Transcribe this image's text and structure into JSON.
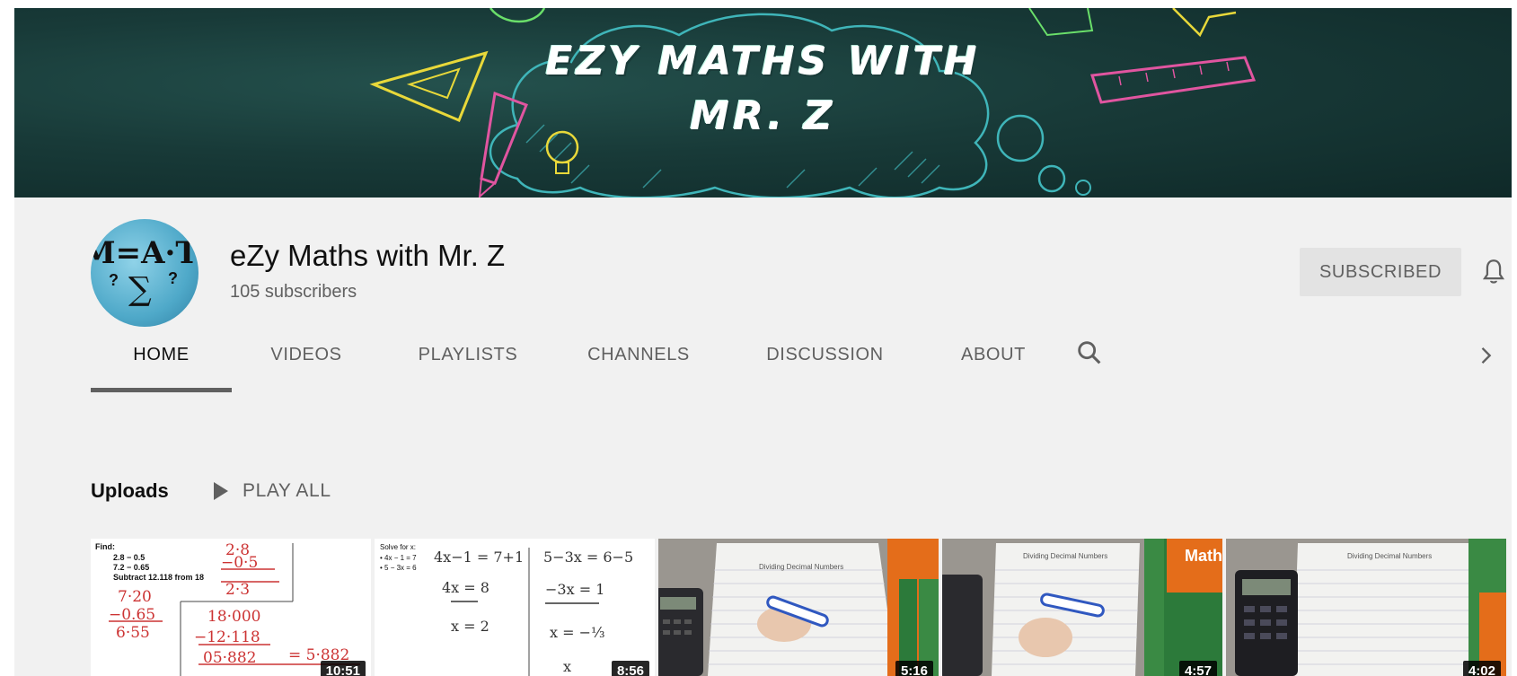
{
  "banner": {
    "title_line1": "EZY MATHS WITH",
    "title_line2": "MR. Z"
  },
  "channel": {
    "name": "eZy Maths with Mr. Z",
    "subscribers": "105 subscribers",
    "avatar_text": "M=A·T+H",
    "avatar_sigma": "∑",
    "subscribe_label": "SUBSCRIBED",
    "colors": {
      "header_bg": "#f1f1f1",
      "button_bg": "#e3e3e3",
      "muted_text": "#606060"
    }
  },
  "tabs": [
    {
      "label": "HOME",
      "active": true
    },
    {
      "label": "VIDEOS",
      "active": false
    },
    {
      "label": "PLAYLISTS",
      "active": false
    },
    {
      "label": "CHANNELS",
      "active": false
    },
    {
      "label": "DISCUSSION",
      "active": false
    },
    {
      "label": "ABOUT",
      "active": false
    }
  ],
  "icons": {
    "search": "search-icon",
    "next": "chevron-right-icon",
    "bell": "bell-icon",
    "play": "play-icon"
  },
  "uploads": {
    "title": "Uploads",
    "play_all_label": "PLAY ALL",
    "videos": [
      {
        "find": "Find:",
        "lines": [
          "2.8 − 0.5",
          "7.2 − 0.65",
          "Subtract 12.118 from 18"
        ],
        "hand": [
          "2·8",
          "−0·5",
          "2·3",
          "7·20",
          "−0.65",
          "6·55",
          "18·000",
          "−12·118",
          "05·882",
          "= 5·882"
        ],
        "duration": "10:51"
      },
      {
        "title": "Solve for x:",
        "lines": [
          "• 4x − 1 = 7",
          "• 5 − 3x = 6"
        ],
        "hand": [
          "4x−1 = 7+1",
          "4x = 8",
          "x = 2",
          "5−3x = 6−5",
          "−3x = 1",
          "x = −⅓",
          "x"
        ],
        "duration": "8:56"
      },
      {
        "paper_title": "Dividing Decimal Numbers",
        "duration": "5:16"
      },
      {
        "paper_title": "Dividing Decimal Numbers",
        "book_text": "Maths for",
        "duration": "4:57"
      },
      {
        "paper_title": "Dividing Decimal Numbers",
        "duration": "4:02"
      }
    ]
  }
}
